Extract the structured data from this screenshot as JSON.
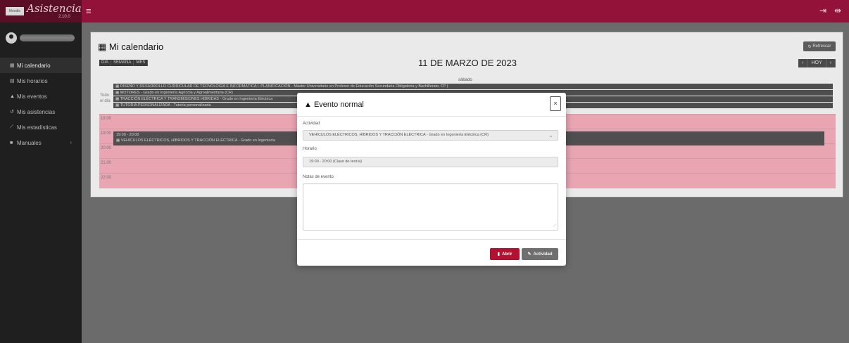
{
  "app": {
    "brand_title": "Asistencia",
    "brand_subtitle": "2.10.0",
    "logo_text": "Moodle",
    "menu_icon": "hamburger-icon",
    "top_icons": [
      "logout-icon",
      "collapse-icon"
    ]
  },
  "sidebar": {
    "items": [
      {
        "icon": "calendar-icon",
        "label": "Mi calendario",
        "active": true
      },
      {
        "icon": "table-icon",
        "label": "Mis horarios"
      },
      {
        "icon": "bell-icon",
        "label": "Mis eventos"
      },
      {
        "icon": "history-icon",
        "label": "Mis asistencias"
      },
      {
        "icon": "chart-icon",
        "label": "Mis estadísticas"
      },
      {
        "icon": "book-icon",
        "label": "Manuales",
        "chevron": "›"
      }
    ]
  },
  "calendar": {
    "title": "Mi calendario",
    "refresh": "Refrescar",
    "views": [
      "DÍA",
      "SEMANA",
      "MES"
    ],
    "date": "11 DE MARZO DE 2023",
    "nav": [
      "‹",
      "HOY",
      "›"
    ],
    "day_name": "sábado",
    "allday_label": "Todo el día",
    "allday_events": [
      "▦ DISEÑO Y DESARROLLO CURRICULAR DE TECNOLOGÍA E INFORMÁTICA I. PLANIFICACIÓN - Máster Universitario en Profesor de Educación Secundaria Obligatoria y Bachillerato, FP (",
      "▦ MOTORES - Grado en Ingeniería Agrícola y Agroalimentaria (CR)",
      "▦ TRACCIÓN ELÉCTRICA Y TRANSMISIONES HÍBRIDAS - Grado en Ingeniería Eléctrica",
      "▦ TUTORÍA PERSONALIZADA - Tutoría personalizada"
    ],
    "hours": [
      "18:00",
      "19:00",
      "20:00",
      "21:00",
      "22:00"
    ],
    "timed_event": {
      "time": "19:00 - 20:00",
      "title": "▦ VEHÍCULOS ELÉCTRICOS, HÍBRIDOS Y TRACCIÓN ELÉCTRICA - Grado en Ingeniería"
    }
  },
  "modal": {
    "title": "Evento normal",
    "close": "×",
    "actividad_label": "Actividad",
    "actividad_value": "VEHÍCULOS ELÉCTRICOS, HÍBRIDOS Y TRACCIÓN ELÉCTRICA - Grado en Ingeniería Eléctrica (CR)",
    "horario_label": "Horario",
    "horario_value": "19:00 - 20:00 (Clase de teoría)",
    "notas_label": "Notas de evento",
    "notas_value": "",
    "btn_open": "Abrir",
    "btn_activity": "Actividad"
  }
}
